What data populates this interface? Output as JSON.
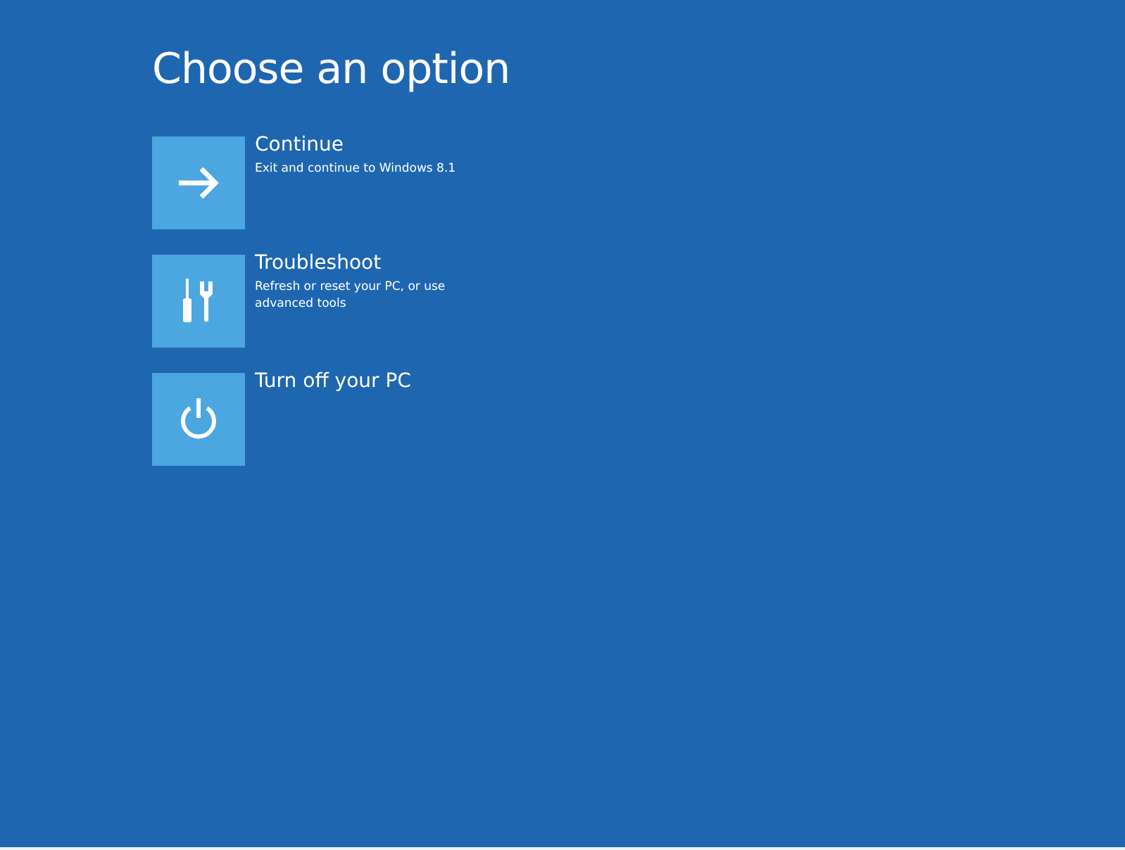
{
  "title": "Choose an option",
  "options": [
    {
      "kind": "continue",
      "label": "Continue",
      "description": "Exit and continue to Windows 8.1"
    },
    {
      "kind": "troubleshoot",
      "label": "Troubleshoot",
      "description": "Refresh or reset your PC, or use advanced tools"
    },
    {
      "kind": "power",
      "label": "Turn off your PC"
    }
  ]
}
